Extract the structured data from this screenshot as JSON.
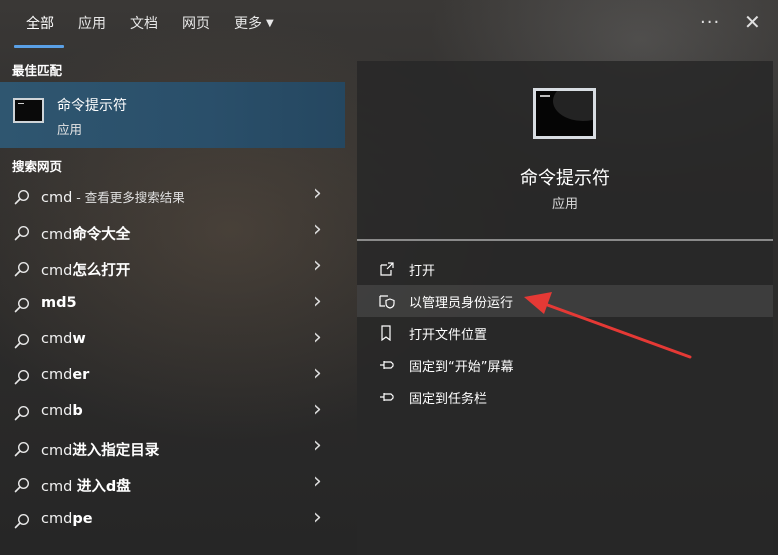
{
  "tabs": [
    {
      "label": "全部",
      "active": true
    },
    {
      "label": "应用"
    },
    {
      "label": "文档"
    },
    {
      "label": "网页"
    },
    {
      "label": "更多"
    }
  ],
  "sections": {
    "best_match": "最佳匹配",
    "search_web": "搜索网页"
  },
  "best_match": {
    "title": "命令提示符",
    "subtitle": "应用",
    "icon": "command-prompt-icon"
  },
  "web_results": [
    {
      "prefix": "cmd",
      "bold": "",
      "suffix": " - 查看更多搜索结果"
    },
    {
      "prefix": "cmd",
      "bold": "命令大全",
      "suffix": ""
    },
    {
      "prefix": "cmd",
      "bold": "怎么打开",
      "suffix": ""
    },
    {
      "prefix": "",
      "bold": "md5",
      "suffix": ""
    },
    {
      "prefix": "cmd",
      "bold": "w",
      "suffix": ""
    },
    {
      "prefix": "cmd",
      "bold": "er",
      "suffix": ""
    },
    {
      "prefix": "cmd",
      "bold": "b",
      "suffix": ""
    },
    {
      "prefix": "cmd",
      "bold": "进入指定目录",
      "suffix": ""
    },
    {
      "prefix": "cmd ",
      "bold": "进入d盘",
      "suffix": ""
    },
    {
      "prefix": "cmd",
      "bold": "pe",
      "suffix": ""
    }
  ],
  "detail": {
    "title": "命令提示符",
    "subtitle": "应用",
    "actions": [
      {
        "label": "打开",
        "icon": "open-icon"
      },
      {
        "label": "以管理员身份运行",
        "icon": "shield-icon",
        "highlighted": true
      },
      {
        "label": "打开文件位置",
        "icon": "file-location-icon"
      },
      {
        "label": "固定到“开始”屏幕",
        "icon": "pin-icon"
      },
      {
        "label": "固定到任务栏",
        "icon": "pin-icon"
      }
    ]
  },
  "colors": {
    "accent": "#5aa0e6",
    "selection": "#2f5670",
    "annotation_arrow": "#e53935"
  }
}
